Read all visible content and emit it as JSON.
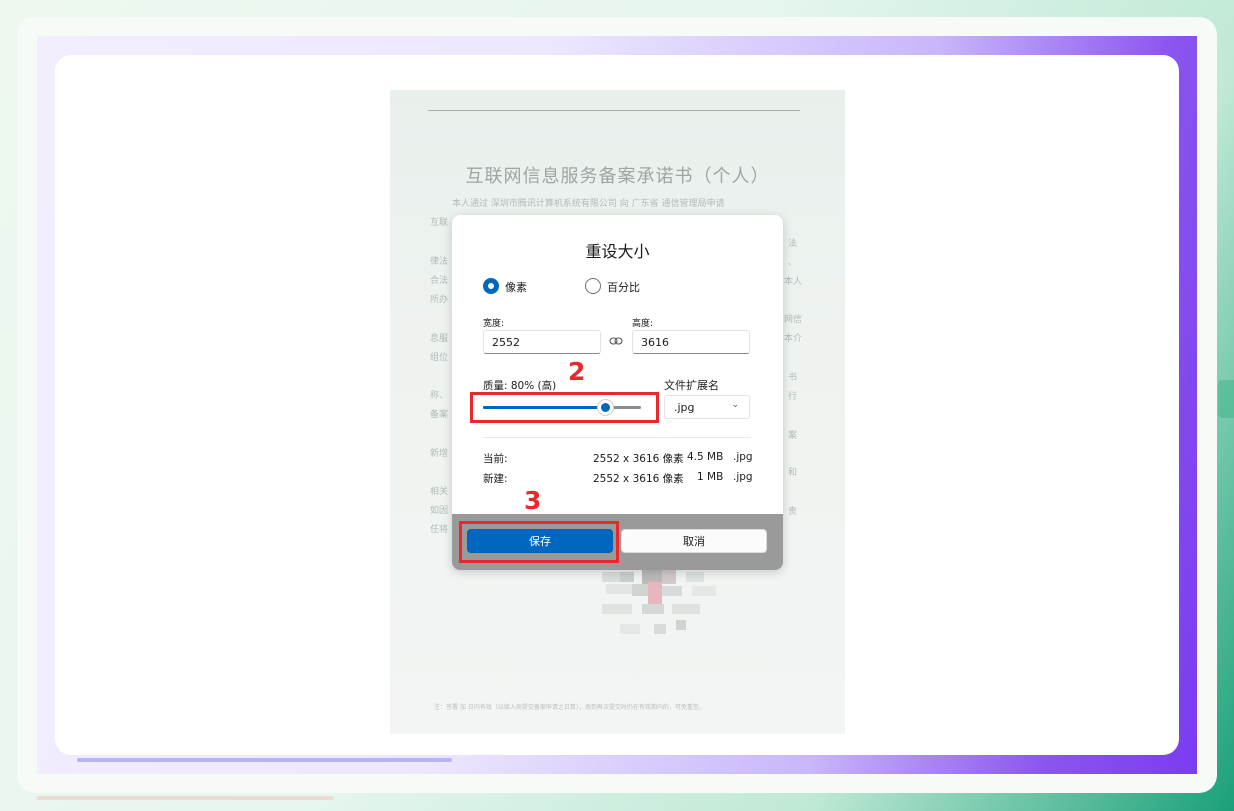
{
  "document": {
    "title": "互联网信息服务备案承诺书（个人）",
    "intro_line": "本人通过 深圳市腾讯计算机系统有限公司 向 广东省 通信管理局申请",
    "left_fragments": [
      "互联",
      "律法",
      "合法",
      "所办",
      "息服",
      "组位",
      "称、",
      "备案",
      "新增",
      "相关",
      "如因",
      "任将"
    ],
    "right_fragments": [
      "法",
      "、",
      "本人",
      "网信",
      "本介",
      "书",
      "行",
      "案",
      "和",
      "责"
    ],
    "footer_note": "注：签署 加 日内有效（以接入商提交备案申请之日算），逾到再次提交时仍在有效期内的，可免重签。"
  },
  "dialog": {
    "title": "重设大小",
    "mode_pixels": "像素",
    "mode_percent": "百分比",
    "selected_mode": "pixels",
    "width_label": "宽度:",
    "width_value": "2552",
    "height_label": "高度:",
    "height_value": "3616",
    "quality_label": "质量: 80% (高)",
    "quality_percent": 80,
    "format_label": "文件扩展名",
    "format_value": ".jpg",
    "current_label": "当前:",
    "current_dims": "2552 x 3616 像素",
    "current_size": "4.5 MB",
    "current_ext": ".jpg",
    "new_label": "新建:",
    "new_dims": "2552 x 3616 像素",
    "new_size": "1 MB",
    "new_ext": ".jpg",
    "save_label": "保存",
    "cancel_label": "取消"
  },
  "annotations": {
    "step2": "2",
    "step3": "3",
    "highlight_color": "#e8282b"
  },
  "colors": {
    "accent": "#0067c0",
    "background_gradient_end": "#1aa07a",
    "purple_band": "#7a3cf0"
  },
  "icons": {
    "link": "chain-link-icon",
    "dropdown": "chevron-down-icon"
  }
}
